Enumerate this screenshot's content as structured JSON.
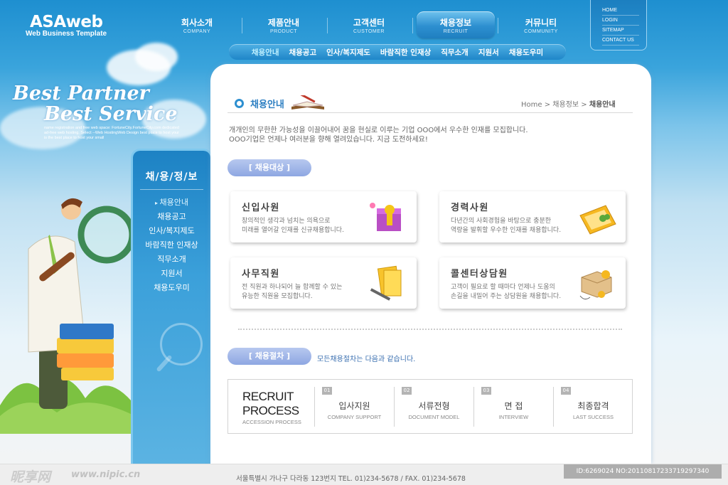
{
  "logo": {
    "title": "ASAweb",
    "subtitle": "Web Business Template"
  },
  "main_nav": [
    {
      "ko": "회사소개",
      "en": "COMPANY"
    },
    {
      "ko": "제품안내",
      "en": "PRODUCT"
    },
    {
      "ko": "고객센터",
      "en": "CUSTOMER"
    },
    {
      "ko": "채용정보",
      "en": "RECRUIT",
      "active": true
    },
    {
      "ko": "커뮤니티",
      "en": "COMMUNITY"
    }
  ],
  "sub_nav": [
    "채용안내",
    "채용공고",
    "인사/복지제도",
    "바람직한 인재상",
    "직무소개",
    "지원서",
    "채용도우미"
  ],
  "util_links": [
    "HOME",
    "LOGIN",
    "SITEMAP",
    "CONTACT US"
  ],
  "slogan": {
    "line1": "Best Partner",
    "line2": "Best Service",
    "desc": "name registration and free web space: FortuneCity.FortuneCity.com dedicated ad-free web hosting. Select --Web HostingWeb Design best place to host your is the best place to host your small"
  },
  "sidebar": {
    "title": "채/용/정/보",
    "items": [
      "채용안내",
      "채용공고",
      "인사/복지제도",
      "바람직한 인재상",
      "직무소개",
      "지원서",
      "채용도우미"
    ]
  },
  "page_title": "채용안내",
  "breadcrumb": {
    "home": "Home",
    "sep": ">",
    "level1": "채용정보",
    "current": "채용안내"
  },
  "intro": {
    "line1": "개개인의 무한한 가능성을 이끌어내어 꿈을 현실로 이루는 기업 OOO에서 우수한 인재를 모집합니다.",
    "line2": "OOO기업은 언제나 여러분을 향해 열려있습니다. 지금 도전하세요!"
  },
  "target_label": "[ 채용대상 ]",
  "cards": [
    {
      "title": "신입사원",
      "line1": "창의적인 생각과 넘치는 의욕으로",
      "line2": "미래를 열어갈 인재를 신규채용합니다."
    },
    {
      "title": "경력사원",
      "line1": "다년간의 사회경험을 바탕으로 충분한",
      "line2": "역량을 발휘할 우수한 인재를 채용합니다."
    },
    {
      "title": "사무직원",
      "line1": "전 직원과 하나되어 늘 함께할 수 있는",
      "line2": "유능한 직원을 모집합니다."
    },
    {
      "title": "콜센터상담원",
      "line1": "고객이 필요로 할 때마다 언제나 도움의",
      "line2": "손길을 내밀어 주는 상담원을 채용합니다."
    }
  ],
  "procedure_label": "[ 채용절차 ]",
  "procedure_note": "모든채용절차는 다음과 같습니다.",
  "process": {
    "title1": "RECRUIT",
    "title2": "PROCESS",
    "subtitle": "ACCESSION PROCESS",
    "steps": [
      {
        "num": "01",
        "ko": "입사지원",
        "en": "COMPANY SUPPORT"
      },
      {
        "num": "02",
        "ko": "서류전형",
        "en": "DOCUMENT MODEL"
      },
      {
        "num": "03",
        "ko": "면 접",
        "en": "INTERVIEW"
      },
      {
        "num": "04",
        "ko": "최종합격",
        "en": "LAST SUCCESS"
      }
    ]
  },
  "footer": {
    "address": "서울특별시 가나구 다라동 123번지 TEL. 01)234-5678 / FAX. 01)234-5678",
    "watermark": "昵享网",
    "watermark_url": "www.nipic.cn",
    "image_id": "ID:6269024 NO:20110817233719297340"
  },
  "colors": {
    "primary": "#2d8fd0",
    "pill": "#9fb4e8",
    "title": "#2d7fc2"
  }
}
